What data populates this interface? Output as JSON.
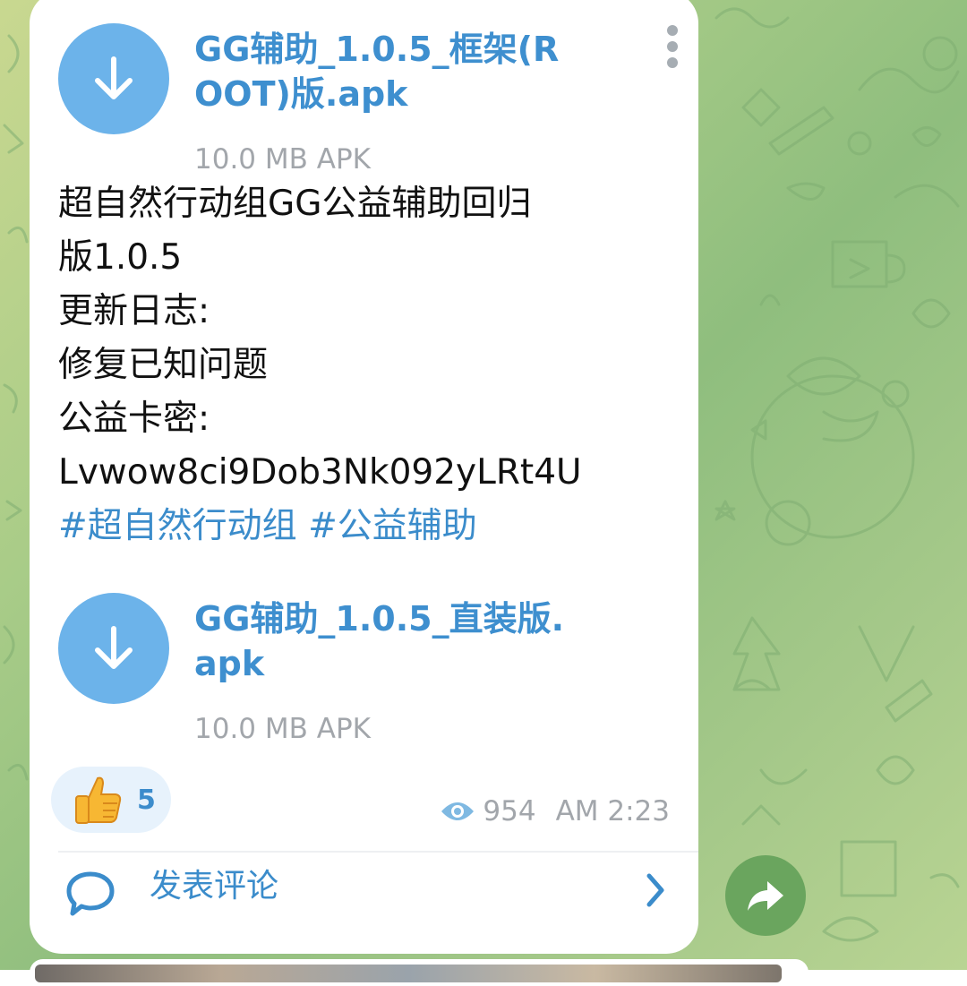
{
  "colors": {
    "accent": "#3e8fcf",
    "download_button": "#6cb3ea",
    "meta_text": "#a2a6ab",
    "share_button": "#6aa55e",
    "bubble": "#ffffff"
  },
  "files": [
    {
      "name": "GG辅助_1.0.5_框架(ROOT)版.apk",
      "meta": "10.0 MB APK",
      "icon": "download-arrow-icon"
    },
    {
      "name": "GG辅助_1.0.5_直装版.apk",
      "meta": "10.0 MB APK",
      "icon": "download-arrow-icon"
    }
  ],
  "message": {
    "lines": [
      "超自然行动组GG公益辅助回归",
      "版1.0.5",
      "更新日志:",
      "修复已知问题",
      "公益卡密:",
      "Lvwow8ci9Dob3Nk092yLRt4U"
    ],
    "hashtags": [
      "#超自然行动组",
      "#公益辅助"
    ]
  },
  "reaction": {
    "emoji": "👍",
    "count": "5"
  },
  "info": {
    "views_icon": "eye-icon",
    "views": "954",
    "time": "AM 2:23"
  },
  "comment": {
    "icon": "comment-bubble-icon",
    "label": "发表评论",
    "chevron": "chevron-right-icon"
  },
  "share": {
    "icon": "share-arrow-icon"
  },
  "menu": {
    "icon": "more-vertical-icon"
  }
}
